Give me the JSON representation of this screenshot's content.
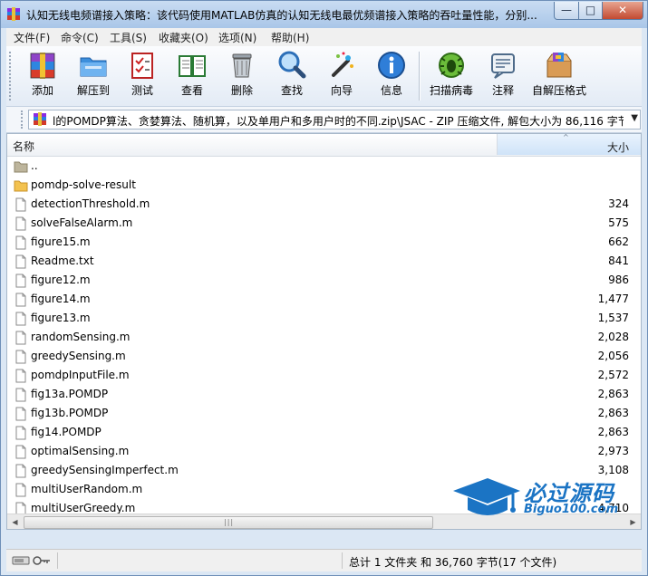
{
  "window": {
    "title": "认知无线电频谱接入策略：该代码使用MATLAB仿真的认知无线电最优频谱接入策略的吞吐量性能，分别...",
    "min_label": "—",
    "max_label": "□",
    "close_label": "✕"
  },
  "menu": [
    "文件(F)",
    "命令(C)",
    "工具(S)",
    "收藏夹(O)",
    "选项(N)",
    "帮助(H)"
  ],
  "toolbar": [
    {
      "label": "添加",
      "icon": "add-archive-icon"
    },
    {
      "label": "解压到",
      "icon": "extract-folder-icon"
    },
    {
      "label": "测试",
      "icon": "test-checklist-icon"
    },
    {
      "label": "查看",
      "icon": "view-book-icon"
    },
    {
      "label": "删除",
      "icon": "trash-icon"
    },
    {
      "label": "查找",
      "icon": "magnifier-icon"
    },
    {
      "label": "向导",
      "icon": "wizard-wand-icon"
    },
    {
      "label": "信息",
      "icon": "info-icon"
    },
    {
      "label": "扫描病毒",
      "icon": "virus-scan-icon"
    },
    {
      "label": "注释",
      "icon": "comment-icon"
    },
    {
      "label": "自解压格式",
      "icon": "sfx-box-icon"
    }
  ],
  "address": {
    "path": "l的POMDP算法、贪婪算法、随机算，以及单用户和多用户时的不同.zip\\JSAC - ZIP 压缩文件, 解包大小为 86,116 字节",
    "dropdown": "▼"
  },
  "list": {
    "columns": {
      "name": "名称",
      "size": "大小"
    },
    "sort_indicator": "^",
    "files": [
      {
        "name": "..",
        "size": "",
        "type": "up"
      },
      {
        "name": "pomdp-solve-result",
        "size": "",
        "type": "folder"
      },
      {
        "name": "detectionThreshold.m",
        "size": "324",
        "type": "file"
      },
      {
        "name": "solveFalseAlarm.m",
        "size": "575",
        "type": "file"
      },
      {
        "name": "figure15.m",
        "size": "662",
        "type": "file"
      },
      {
        "name": "Readme.txt",
        "size": "841",
        "type": "file"
      },
      {
        "name": "figure12.m",
        "size": "986",
        "type": "file"
      },
      {
        "name": "figure14.m",
        "size": "1,477",
        "type": "file"
      },
      {
        "name": "figure13.m",
        "size": "1,537",
        "type": "file"
      },
      {
        "name": "randomSensing.m",
        "size": "2,028",
        "type": "file"
      },
      {
        "name": "greedySensing.m",
        "size": "2,056",
        "type": "file"
      },
      {
        "name": "pomdpInputFile.m",
        "size": "2,572",
        "type": "file"
      },
      {
        "name": "fig13a.POMDP",
        "size": "2,863",
        "type": "file"
      },
      {
        "name": "fig13b.POMDP",
        "size": "2,863",
        "type": "file"
      },
      {
        "name": "fig14.POMDP",
        "size": "2,863",
        "type": "file"
      },
      {
        "name": "optimalSensing.m",
        "size": "2,973",
        "type": "file"
      },
      {
        "name": "greedySensingImperfect.m",
        "size": "3,108",
        "type": "file"
      },
      {
        "name": "multiUserRandom.m",
        "size": "",
        "type": "file"
      },
      {
        "name": "multiUserGreedy.m",
        "size": "4,710",
        "type": "file"
      }
    ]
  },
  "scrollbar": {
    "left": "◀",
    "right": "▶",
    "grip": "|||"
  },
  "status": {
    "summary": "总计 1 文件夹 和 36,760 字节(17 个文件)"
  },
  "watermark": {
    "text": "必过源码",
    "sub": "Biguo100.com"
  },
  "colors": {
    "accent": "#1b74c4",
    "title_bar": "#b7cfec"
  }
}
